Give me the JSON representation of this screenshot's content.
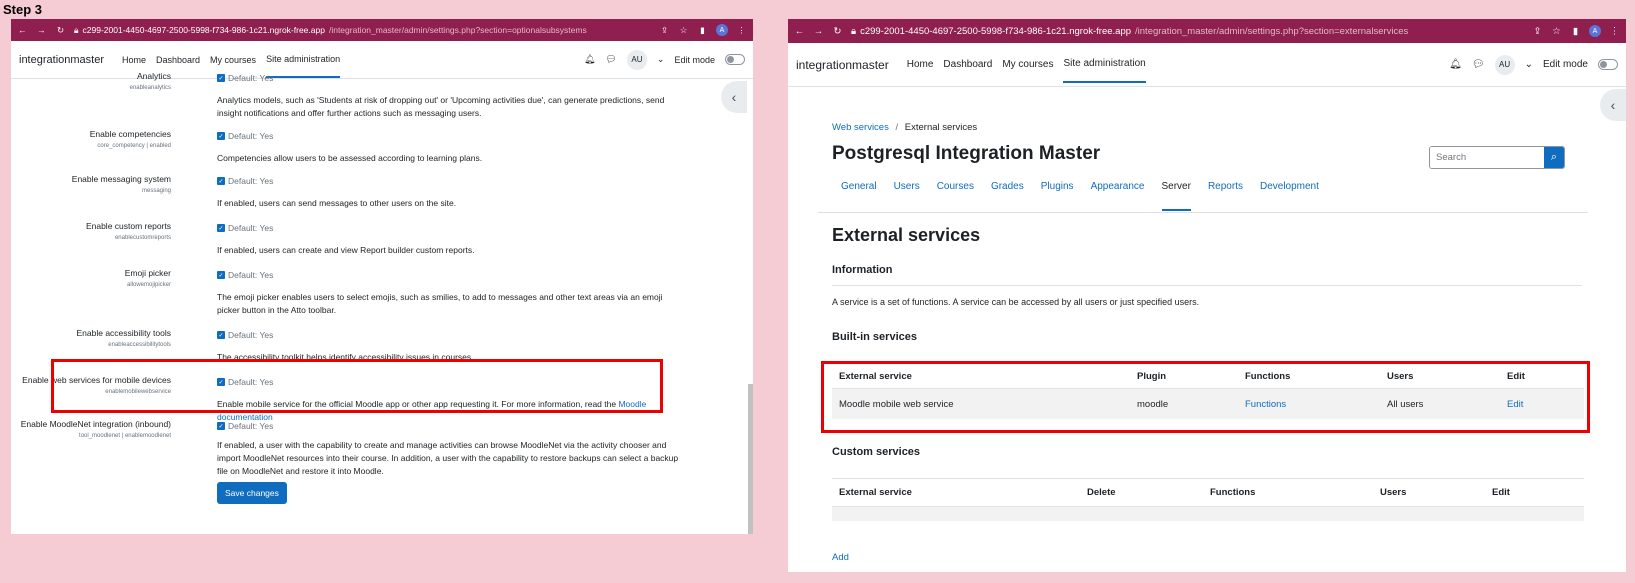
{
  "step": "Step 3",
  "left": {
    "url_host": "c299-2001-4450-4697-2500-5998-f734-986-1c21.ngrok-free.app",
    "url_path": "/integration_master/admin/settings.php?section=optionalsubsystems",
    "profile_initial": "A",
    "brand": "integrationmaster",
    "nav": [
      "Home",
      "Dashboard",
      "My courses",
      "Site administration"
    ],
    "avatar": "AU",
    "edit_mode": "Edit mode",
    "default_label": "Default: Yes",
    "settings": [
      {
        "label": "Analytics",
        "key": "enableanalytics",
        "desc": "Analytics models, such as 'Students at risk of dropping out' or 'Upcoming activities due', can generate predictions, send insight notifications and offer further actions such as messaging users."
      },
      {
        "label": "Enable competencies",
        "key": "core_competency | enabled",
        "desc": "Competencies allow users to be assessed according to learning plans."
      },
      {
        "label": "Enable messaging system",
        "key": "messaging",
        "desc": "If enabled, users can send messages to other users on the site."
      },
      {
        "label": "Enable custom reports",
        "key": "enablecustomreports",
        "desc": "If enabled, users can create and view Report builder custom reports."
      },
      {
        "label": "Emoji picker",
        "key": "allowemojipicker",
        "desc": "The emoji picker enables users to select emojis, such as smilies, to add to messages and other text areas via an emoji picker button in the Atto toolbar."
      },
      {
        "label": "Enable accessibility tools",
        "key": "enableaccessibilitytools",
        "desc": "The accessibility toolkit helps identify accessibility issues in courses."
      },
      {
        "label": "Enable web services for mobile devices",
        "key": "enablemobilewebservice",
        "desc": "Enable mobile service for the official Moodle app or other app requesting it. For more information, read the ",
        "link": "Moodle documentation"
      },
      {
        "label": "Enable MoodleNet integration (inbound)",
        "key": "tool_moodlenet | enablemoodlenet",
        "desc": "If enabled, a user with the capability to create and manage activities can browse MoodleNet via the activity chooser and import MoodleNet resources into their course. In addition, a user with the capability to restore backups can select a backup file on MoodleNet and restore it into Moodle."
      }
    ],
    "save": "Save changes"
  },
  "right": {
    "url_host": "c299-2001-4450-4697-2500-5998-f734-986-1c21.ngrok-free.app",
    "url_path": "/integration_master/admin/settings.php?section=externalservices",
    "profile_initial": "A",
    "brand": "integrationmaster",
    "nav": [
      "Home",
      "Dashboard",
      "My courses",
      "Site administration"
    ],
    "avatar": "AU",
    "edit_mode": "Edit mode",
    "breadcrumb_link": "Web services",
    "breadcrumb_current": "External services",
    "site_title": "Postgresql Integration Master",
    "search_placeholder": "Search",
    "tabs": [
      "General",
      "Users",
      "Courses",
      "Grades",
      "Plugins",
      "Appearance",
      "Server",
      "Reports",
      "Development"
    ],
    "heading": "External services",
    "info_heading": "Information",
    "info_text": "A service is a set of functions. A service can be accessed by all users or just specified users.",
    "builtin_heading": "Built-in services",
    "builtin_cols": [
      "External service",
      "Plugin",
      "Functions",
      "Users",
      "Edit"
    ],
    "builtin_row": {
      "service": "Moodle mobile web service",
      "plugin": "moodle",
      "functions": "Functions",
      "users": "All users",
      "edit": "Edit"
    },
    "custom_heading": "Custom services",
    "custom_cols": [
      "External service",
      "Delete",
      "Functions",
      "Users",
      "Edit"
    ],
    "add": "Add"
  }
}
